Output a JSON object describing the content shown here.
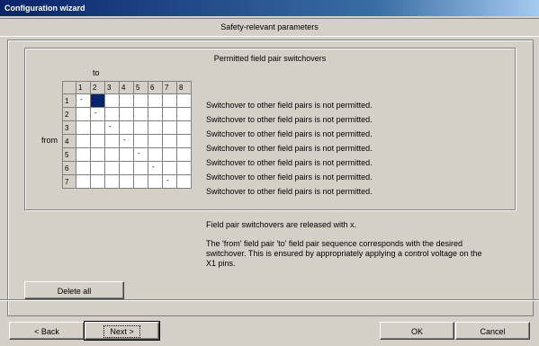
{
  "window": {
    "title": "Configuration wizard"
  },
  "section": {
    "title": "Safety-relevant parameters"
  },
  "group": {
    "title": "Permitted field pair switchovers",
    "to_label": "to",
    "from_label": "from",
    "columns": [
      "1",
      "2",
      "3",
      "4",
      "5",
      "6",
      "7",
      "8"
    ],
    "rows": [
      "1",
      "2",
      "3",
      "4",
      "5",
      "6",
      "7"
    ],
    "selected_cell": {
      "row": 1,
      "col": 2
    },
    "messages": [
      "Switchover to other field pairs is not permitted.",
      "Switchover to other field pairs is not permitted.",
      "Switchover to other field pairs is not permitted.",
      "Switchover to other field pairs is not permitted.",
      "Switchover to other field pairs is not permitted.",
      "Switchover to other field pairs is not permitted.",
      "Switchover to other field pairs is not permitted."
    ]
  },
  "info": {
    "line1": "Field pair switchovers are released with  x.",
    "line2a": "The 'from' field pair 'to' field pair sequence corresponds with the desired",
    "line2b": "switchover. This is ensured by appropriately applying a control voltage on the",
    "line2c": "X1 pins."
  },
  "buttons": {
    "delete_all": "Delete all",
    "back": "< Back",
    "next": "Next >",
    "ok": "OK",
    "cancel": "Cancel"
  }
}
